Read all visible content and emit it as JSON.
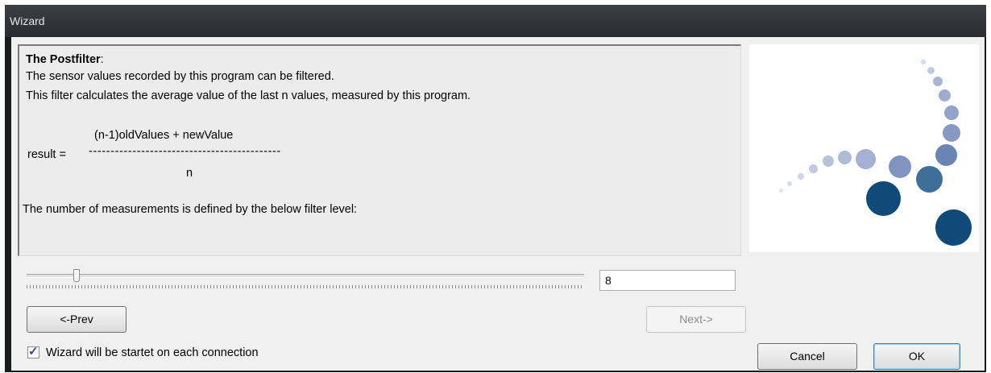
{
  "window": {
    "title": "Wizard"
  },
  "panel": {
    "heading": "The Postfilter",
    "heading_suffix": ":",
    "line1": "The sensor values recorded by this program can be filtered.",
    "line2": "This filter calculates the average value of the last n values, measured by this program.",
    "formula_numerator": "(n-1)oldValues + newValue",
    "formula_lhs": "result =",
    "formula_bar": "--------------------------------------------",
    "formula_denominator": "n",
    "line3": "The number of measurements is defined by the below filter level:"
  },
  "filter": {
    "value": "8"
  },
  "buttons": {
    "prev": "<-Prev",
    "next": "Next->",
    "cancel": "Cancel",
    "ok": "OK"
  },
  "checkbox": {
    "label": "Wizard will be startet on each connection",
    "checked": true
  },
  "colors": {
    "logo_dark": "#0f4a78",
    "logo_mid": "#3f6f98",
    "logo_light": "#8fa3c7"
  }
}
